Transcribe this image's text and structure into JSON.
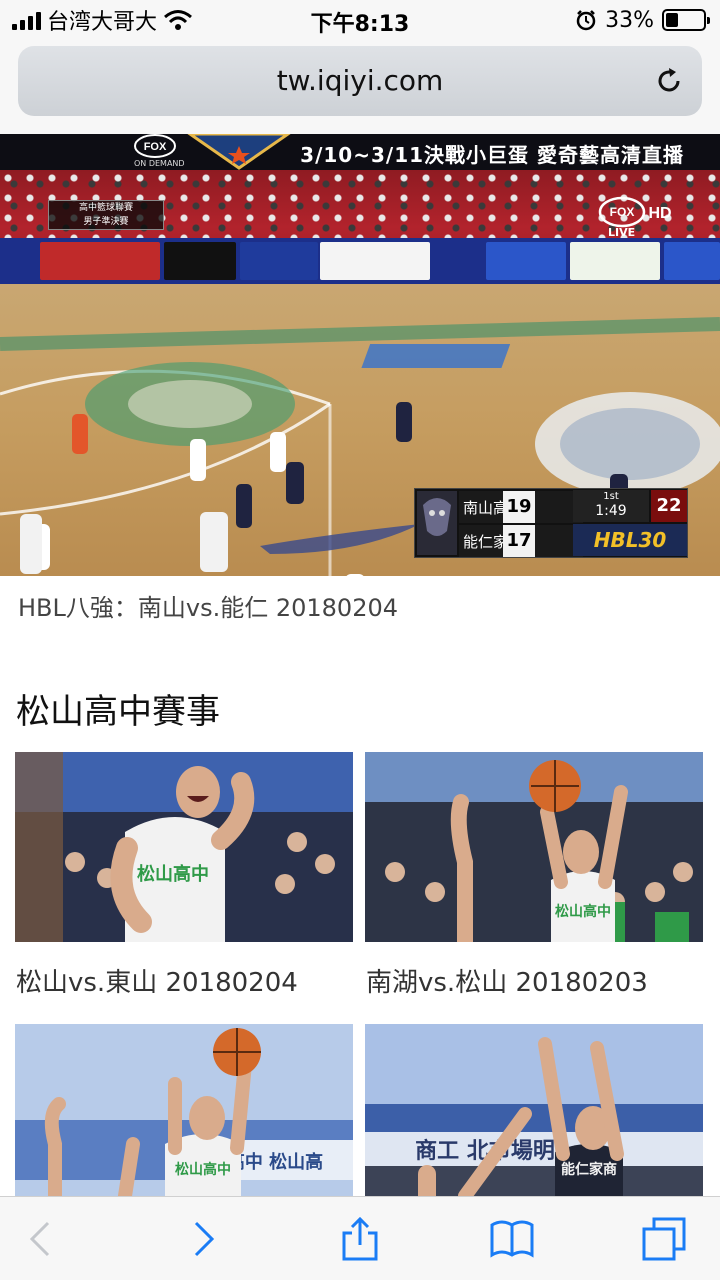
{
  "status_bar": {
    "carrier": "台湾大哥大",
    "time": "下午8:13",
    "battery": "33%",
    "battery_level": 0.33,
    "icons": [
      "signal-icon",
      "wifi-icon",
      "alarm-icon",
      "battery-icon"
    ]
  },
  "browser": {
    "url": "tw.iqiyi.com"
  },
  "video": {
    "banner_text": "3/10~3/11決戰小巨蛋 愛奇藝高清直播",
    "broadcaster_logo": "FOX",
    "on_demand": "ON DEMAND",
    "corner_overlay_line1": "高中籃球聯賽",
    "corner_overlay_line2": "男子準決賽",
    "live_label": "LIVE",
    "scoreboard": {
      "team1": "南山高中",
      "team1_score": "19",
      "team2": "能仁家商",
      "team2_score": "17",
      "period": "1st",
      "clock": "1:49",
      "shot_clock": "22",
      "league": "HBL30"
    },
    "caption": "HBL八強：南山vs.能仁 20180204"
  },
  "section": {
    "title": "松山高中賽事"
  },
  "videos": [
    {
      "caption": "松山vs.東山 20180204"
    },
    {
      "caption": "南湖vs.松山 20180203"
    },
    {
      "caption": ""
    },
    {
      "caption": ""
    }
  ],
  "toolbar": {
    "icons": [
      "back-icon",
      "forward-icon",
      "share-icon",
      "bookmarks-icon",
      "tabs-icon"
    ]
  },
  "colors": {
    "ios_blue": "#1a7cf5",
    "jersey_green": "#2f9a48",
    "crowd_red": "#b2232c"
  }
}
